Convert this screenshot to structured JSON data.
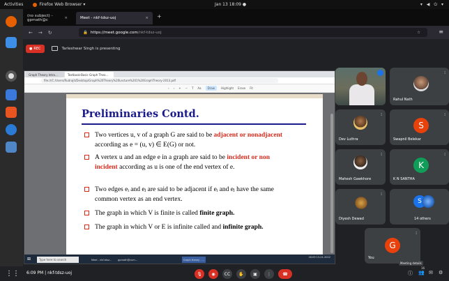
{
  "os": {
    "activities": "Activities",
    "app_name": "Firefox Web Browser ▾",
    "clock": "Jan 13  18:09 ●",
    "tray": "▾ ◀ ⏻ ▾"
  },
  "browser": {
    "tabs": [
      {
        "title": "(no subject) - gpmath@c"
      },
      {
        "title": "Meet - nkf-tdsz-uoj"
      }
    ],
    "url_host": "https://meet.google.com",
    "url_path": "/nkf-tdsz-uoj"
  },
  "meet": {
    "rec_label": "REC",
    "presenter_text": "Tarleshwar Singh is presenting",
    "time": "6:09 PM",
    "separator": "|",
    "meeting_code": "nkf-tdsz-uoj",
    "tooltip": "Meeting details",
    "participants_badge": "16"
  },
  "shared_screen": {
    "tabs": [
      "Graph Theory Intro…",
      "Textbook-Basic Graph Theo…"
    ],
    "address": "file:///C:/Users/Rudrajit/Desktop/Graph%20Theory%20Lecture%201%20GraphTheory-2013.pdf",
    "toolbar": [
      "‹",
      "›",
      "+",
      "−",
      "T",
      "Aa",
      "Draw",
      "Highlight",
      "Erase",
      "Fit"
    ],
    "search_placeholder": "Type here to search",
    "taskbar_items": [
      "Meet - nkf-tdsz…",
      "gpmath@cum…",
      "Graph theory - …"
    ],
    "taskbar_clock": "18:09\n13-01-2022"
  },
  "slide": {
    "title": "Preliminaries Contd.",
    "bullets": [
      {
        "pre": "Two vertices u, v of a graph G are said to be ",
        "em": "adjacent or nonadjacent",
        "post": " according as e = (u, v) ∈ E(G) or not."
      },
      {
        "pre": "A vertex u and an edge e in a graph are said to be ",
        "em": "incident or non incident",
        "post": " according as u is one of the end vertex of e."
      },
      {
        "pre": "Two edges eᵢ and eⱼ are said to be adjacent if eᵢ and eⱼ have the same common vertex as an end vertex.",
        "em": "",
        "post": ""
      },
      {
        "pre": "The graph in which V is finite is called ",
        "em": "finite graph.",
        "post": ""
      },
      {
        "pre": "The graph in which V or E is infinite called and ",
        "em": "infinite graph.",
        "post": ""
      }
    ]
  },
  "participants": [
    {
      "name": "",
      "initial": "",
      "color": "#1a73e8"
    },
    {
      "name": "Rahul Nath",
      "initial": "",
      "color": ""
    },
    {
      "name": "Dev Luthra",
      "initial": "",
      "color": ""
    },
    {
      "name": "Swapnil Belekar",
      "initial": "S",
      "color": "#e8410b"
    },
    {
      "name": "Mahesh Gawkhore",
      "initial": "",
      "color": ""
    },
    {
      "name": "K N SANTHA",
      "initial": "K",
      "color": "#0f9d58"
    },
    {
      "name": "Diyesh Dewad",
      "initial": "",
      "color": ""
    },
    {
      "name": "14 others",
      "initial": "S",
      "color": "#1a73e8"
    },
    {
      "name": "You",
      "initial": "G",
      "color": "#e8410b"
    }
  ],
  "controls": {
    "mic_icon": "mic-off",
    "cam_icon": "cam-off",
    "cc_icon": "cc",
    "hand_icon": "hand",
    "present_icon": "present",
    "more_icon": "⋮",
    "hangup_icon": "hangup"
  }
}
